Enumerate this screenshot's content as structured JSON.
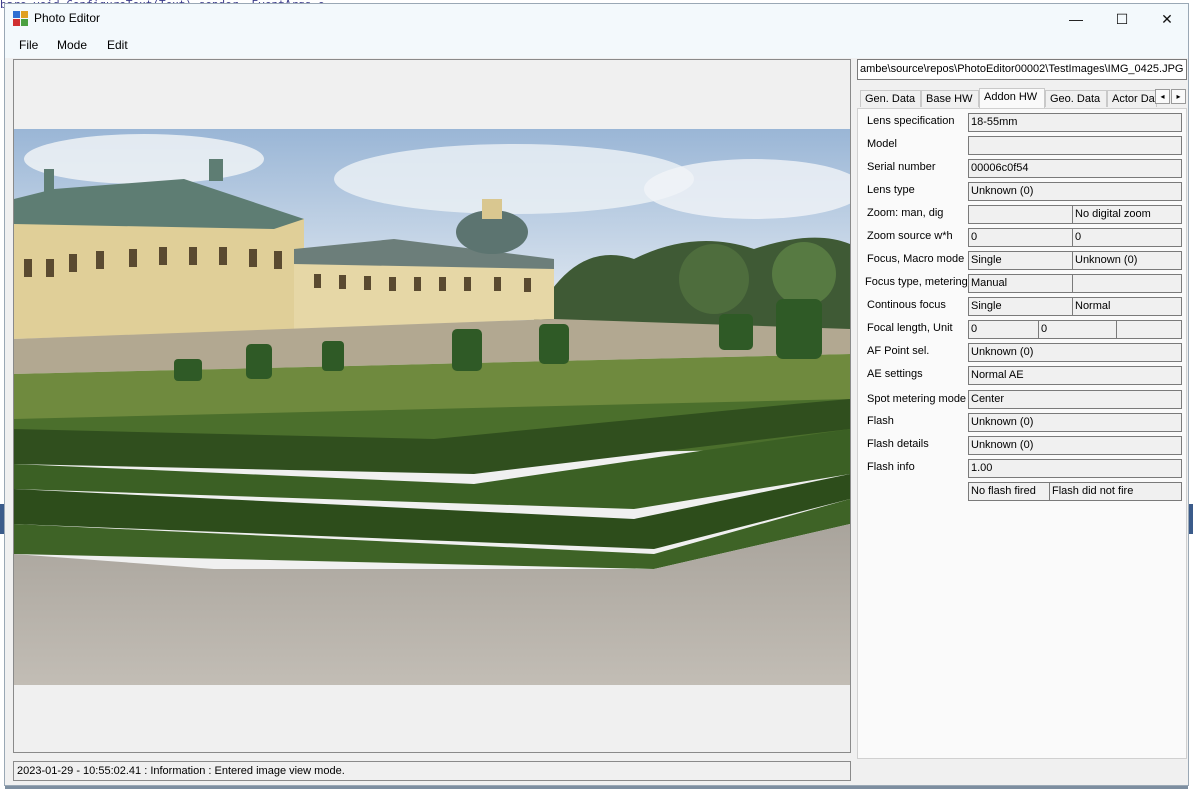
{
  "background": {
    "code_text": "bare void ConfigureText(Text) sender, EventArgs e"
  },
  "window": {
    "title": "Photo Editor",
    "controls": {
      "minimize": "—",
      "maximize": "☐",
      "close": "✕"
    }
  },
  "menu": {
    "file": "File",
    "mode": "Mode",
    "edit": "Edit"
  },
  "file_path": "ambe\\source\\repos\\PhotoEditor00002\\TestImages\\IMG_0425.JPG",
  "tabs": {
    "items": [
      "Gen. Data",
      "Base HW",
      "Addon HW",
      "Geo. Data",
      "Actor Dat"
    ],
    "active": "Addon HW",
    "scroll_left": "◂",
    "scroll_right": "▸"
  },
  "addon_hw": {
    "lens_spec": {
      "label": "Lens specification",
      "value": "18-55mm"
    },
    "model": {
      "label": "Model",
      "value": ""
    },
    "serial": {
      "label": "Serial number",
      "value": "00006c0f54"
    },
    "lens_type": {
      "label": "Lens type",
      "value": "Unknown (0)"
    },
    "zoom_man_dig": {
      "label": "Zoom: man, dig",
      "value1": "",
      "value2": "No digital zoom"
    },
    "zoom_source": {
      "label": "Zoom source w*h",
      "value1": "0",
      "value2": "0"
    },
    "focus_macro": {
      "label": "Focus, Macro mode",
      "value1": "Single",
      "value2": "Unknown (0)"
    },
    "focus_type": {
      "label": "Focus type, metering",
      "value1": "Manual",
      "value2": ""
    },
    "continous_focus": {
      "label": "Continous focus",
      "value1": "Single",
      "value2": "Normal"
    },
    "focal_length": {
      "label": "Focal length, Unit",
      "value1": "0",
      "value2": "0",
      "value3": ""
    },
    "af_point": {
      "label": "AF Point sel.",
      "value": "Unknown (0)"
    },
    "ae_settings": {
      "label": "AE settings",
      "value": "Normal AE"
    },
    "spot_metering": {
      "label": "Spot metering mode",
      "value": "Center"
    },
    "flash": {
      "label": "Flash",
      "value": "Unknown (0)"
    },
    "flash_details": {
      "label": "Flash details",
      "value": "Unknown (0)"
    },
    "flash_info": {
      "label": "Flash info",
      "value": "1.00",
      "value_a": "No flash fired",
      "value_b": "Flash did not fire"
    }
  },
  "status_text": "2023-01-29 - 10:55:02.41 : Information : Entered image view mode."
}
